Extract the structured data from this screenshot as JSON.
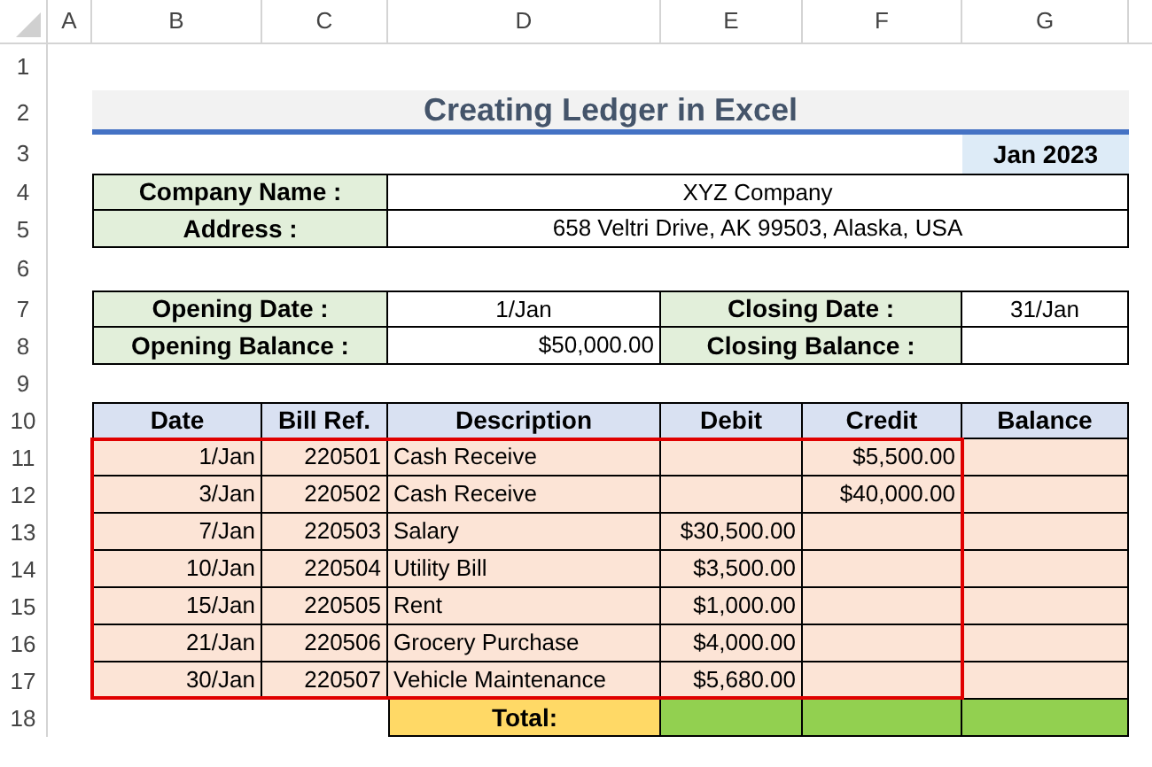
{
  "column_headers": [
    "A",
    "B",
    "C",
    "D",
    "E",
    "F",
    "G"
  ],
  "row_numbers": [
    "1",
    "2",
    "3",
    "4",
    "5",
    "6",
    "7",
    "8",
    "9",
    "10",
    "11",
    "12",
    "13",
    "14",
    "15",
    "16",
    "17",
    "18"
  ],
  "title": "Creating Ledger in Excel",
  "month": "Jan 2023",
  "company": {
    "name_label": "Company Name :",
    "name": "XYZ Company",
    "address_label": "Address :",
    "address": "658 Veltri Drive, AK 99503, Alaska, USA"
  },
  "period": {
    "opening_date_label": "Opening Date :",
    "opening_date": "1/Jan",
    "closing_date_label": "Closing Date :",
    "closing_date": "31/Jan",
    "opening_balance_label": "Opening Balance :",
    "opening_balance": "$50,000.00",
    "closing_balance_label": "Closing Balance :"
  },
  "ledger": {
    "columns": [
      "Date",
      "Bill Ref.",
      "Description",
      "Debit",
      "Credit",
      "Balance"
    ],
    "rows": [
      {
        "date": "1/Jan",
        "bill_ref": "220501",
        "description": "Cash Receive",
        "credit": "$5,500.00"
      },
      {
        "date": "3/Jan",
        "bill_ref": "220502",
        "description": "Cash Receive",
        "credit": "$40,000.00"
      },
      {
        "date": "7/Jan",
        "bill_ref": "220503",
        "description": "Salary",
        "debit": "$30,500.00"
      },
      {
        "date": "10/Jan",
        "bill_ref": "220504",
        "description": "Utility Bill",
        "debit": "$3,500.00"
      },
      {
        "date": "15/Jan",
        "bill_ref": "220505",
        "description": "Rent",
        "debit": "$1,000.00"
      },
      {
        "date": "21/Jan",
        "bill_ref": "220506",
        "description": "Grocery Purchase",
        "debit": "$4,000.00"
      },
      {
        "date": "30/Jan",
        "bill_ref": "220507",
        "description": "Vehicle Maintenance",
        "debit": "$5,680.00"
      }
    ],
    "total_label": "Total:"
  }
}
